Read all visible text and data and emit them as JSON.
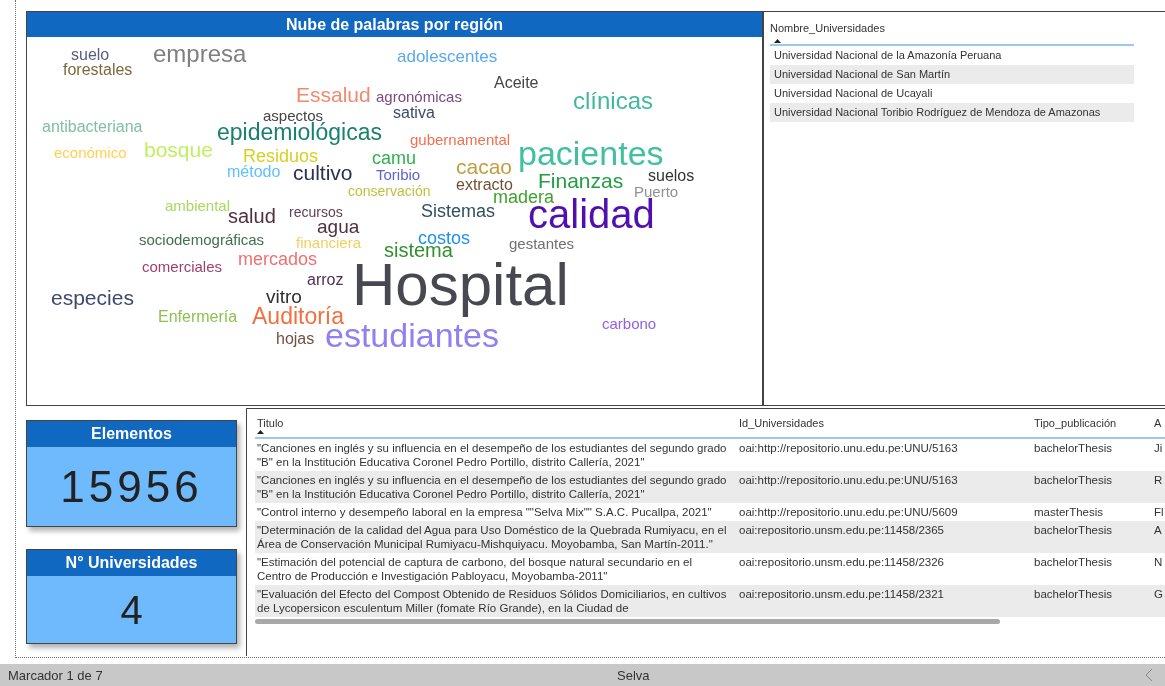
{
  "word_cloud": {
    "title": "Nube de palabras por región",
    "words": [
      {
        "text": "suelo",
        "color": "#5a5a80"
      },
      {
        "text": "empresa",
        "color": "#7f7f7f"
      },
      {
        "text": "adolescentes",
        "color": "#5aa8f0"
      },
      {
        "text": "forestales",
        "color": "#7a6a3a"
      },
      {
        "text": "Aceite",
        "color": "#444444"
      },
      {
        "text": "Essalud",
        "color": "#f08a70"
      },
      {
        "text": "agronómicas",
        "color": "#7a4a7a"
      },
      {
        "text": "clínicas",
        "color": "#40b8a0"
      },
      {
        "text": "sativa",
        "color": "#3a4a6a"
      },
      {
        "text": "aspectos",
        "color": "#444444"
      },
      {
        "text": "antibacteriana",
        "color": "#80c0a0"
      },
      {
        "text": "epidemiológicas",
        "color": "#1a8070"
      },
      {
        "text": "gubernamental",
        "color": "#f07050"
      },
      {
        "text": "económico",
        "color": "#ffd050"
      },
      {
        "text": "bosque",
        "color": "#c0f060"
      },
      {
        "text": "Residuos",
        "color": "#d8d020"
      },
      {
        "text": "camu",
        "color": "#30b050"
      },
      {
        "text": "pacientes",
        "color": "#40c0a0"
      },
      {
        "text": "método",
        "color": "#60c0ff"
      },
      {
        "text": "cultivo",
        "color": "#2a3050"
      },
      {
        "text": "Toribio",
        "color": "#6060d0"
      },
      {
        "text": "cacao",
        "color": "#c0a040"
      },
      {
        "text": "extracto",
        "color": "#705030"
      },
      {
        "text": "Finanzas",
        "color": "#20a040"
      },
      {
        "text": "suelos",
        "color": "#333333"
      },
      {
        "text": "conservación",
        "color": "#c0c040"
      },
      {
        "text": "madera",
        "color": "#40a030"
      },
      {
        "text": "Puerto",
        "color": "#909090"
      },
      {
        "text": "ambiental",
        "color": "#a8d860"
      },
      {
        "text": "salud",
        "color": "#503040"
      },
      {
        "text": "recursos",
        "color": "#604050"
      },
      {
        "text": "agua",
        "color": "#503040"
      },
      {
        "text": "Sistemas",
        "color": "#305060"
      },
      {
        "text": "calidad",
        "color": "#5010b0"
      },
      {
        "text": "sociodemográficas",
        "color": "#407050"
      },
      {
        "text": "financiera",
        "color": "#f0d060"
      },
      {
        "text": "sistema",
        "color": "#309030"
      },
      {
        "text": "costos",
        "color": "#2090f0"
      },
      {
        "text": "gestantes",
        "color": "#707070"
      },
      {
        "text": "comerciales",
        "color": "#a04070"
      },
      {
        "text": "mercados",
        "color": "#f07070"
      },
      {
        "text": "especies",
        "color": "#404870"
      },
      {
        "text": "vitro",
        "color": "#303030"
      },
      {
        "text": "arroz",
        "color": "#503050"
      },
      {
        "text": "Hospital",
        "color": "#484850"
      },
      {
        "text": "Enfermería",
        "color": "#90c050"
      },
      {
        "text": "Auditoría",
        "color": "#f07040"
      },
      {
        "text": "hojas",
        "color": "#705040"
      },
      {
        "text": "estudiantes",
        "color": "#9080f0"
      },
      {
        "text": "carbono",
        "color": "#9060e0"
      }
    ]
  },
  "universities": {
    "column": "Nombre_Universidades",
    "rows": [
      "Universidad Nacional de la Amazonía Peruana",
      "Universidad Nacional de San Martín",
      "Universidad Nacional de Ucayali",
      "Universidad Nacional Toribio Rodríguez de Mendoza de Amazonas"
    ]
  },
  "cards": [
    {
      "title": "Elementos",
      "value": "15956"
    },
    {
      "title": "N° Universidades",
      "value": "4"
    }
  ],
  "table": {
    "columns": [
      "Titulo",
      "Id_Universidades",
      "Tipo_publicación",
      "A"
    ],
    "rows": [
      [
        "\"Canciones en inglés y su influencia en el desempeño de los estudiantes del segundo grado \"B\" en la Institución Educativa Coronel Pedro Portillo, distrito Callería, 2021\"",
        "oai:http://repositorio.unu.edu.pe:UNU/5163",
        "bachelorThesis",
        "Ji"
      ],
      [
        "\"Canciones en inglés y su influencia en el desempeño de los estudiantes del segundo grado \"B\" en la Institución Educativa Coronel Pedro Portillo, distrito Callería, 2021\"",
        "oai:http://repositorio.unu.edu.pe:UNU/5163",
        "bachelorThesis",
        "R"
      ],
      [
        "\"Control interno y desempeño laboral en la empresa \"\"Selva Mix\"\" S.A.C. Pucallpa, 2021\"",
        "oai:http://repositorio.unu.edu.pe:UNU/5609",
        "masterThesis",
        "Fl"
      ],
      [
        "\"Determinación de la calidad del Agua para Uso Doméstico de la Quebrada Rumiyacu, en el Área de Conservación Municipal Rumiyacu-Mishquiyacu. Moyobamba, San Martín-2011.\"",
        "oai:repositorio.unsm.edu.pe:11458/2365",
        "bachelorThesis",
        "A"
      ],
      [
        "\"Estimación del potencial de captura de carbono, del bosque natural secundario en el Centro de Producción e Investigación Pabloyacu, Moyobamba-2011\"",
        "oai:repositorio.unsm.edu.pe:11458/2326",
        "bachelorThesis",
        "N"
      ],
      [
        "\"Evaluación del Efecto del Compost Obtenido de Residuos Sólidos Domiciliarios, en cultivos de Lycopersicon esculentum Miller (fomate Río Grande), en la Ciudad de",
        "oai:repositorio.unsm.edu.pe:11458/2321",
        "bachelorThesis",
        "G"
      ]
    ]
  },
  "status_bar": {
    "bookmark": "Marcador 1 de 7",
    "page": "Selva"
  }
}
